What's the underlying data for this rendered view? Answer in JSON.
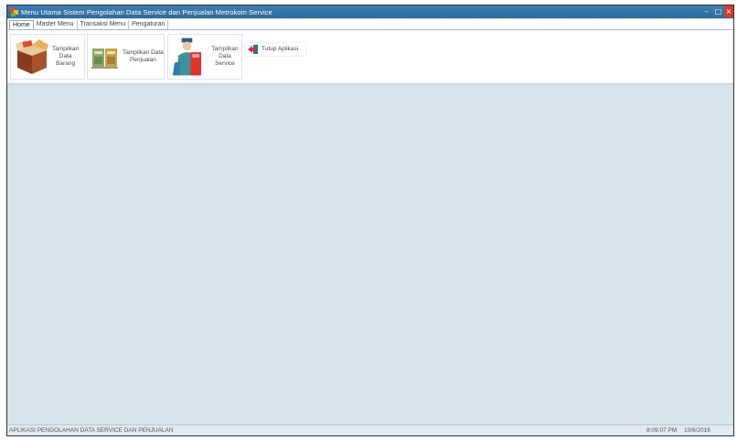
{
  "window": {
    "title": "Menu Utama Sistem Pengolahan Data Service dan Penjualan Metrokom Service",
    "minimize_glyph": "–",
    "maximize_glyph": "□",
    "close_glyph": "×"
  },
  "tabs": [
    "Home",
    "Master Menu",
    "Transaksi Menu",
    "Pengaturan"
  ],
  "ribbon": {
    "buttons": [
      {
        "label": "Tampilkan Data Barang",
        "icon": "box-icon"
      },
      {
        "label": "Tampilkan Data Penjualan",
        "icon": "books-icon"
      },
      {
        "label": "Tampilkan Data Service",
        "icon": "technician-icon"
      },
      {
        "label": "Tutup Aplikasi",
        "icon": "exit-icon"
      }
    ],
    "b1_line1": "Tampilkan",
    "b1_line2": "Data",
    "b1_line3": "Barang",
    "b2_line1": "Tampilkan Data",
    "b2_line2": "Penjualan",
    "b3_line1": "Tampilkan",
    "b3_line2": "Data Service",
    "b4_label": "Tutup Aplikasi"
  },
  "status": {
    "app_name": "APLIKASI PENGOLAHAN DATA SERVICE DAN PENJUALAN",
    "time": "8:09:07 PM",
    "date": "10/6/2016"
  },
  "colors": {
    "titlebar": "#2f6ea0",
    "workspace": "#d8e4ec",
    "close_button": "#d23a2a"
  }
}
